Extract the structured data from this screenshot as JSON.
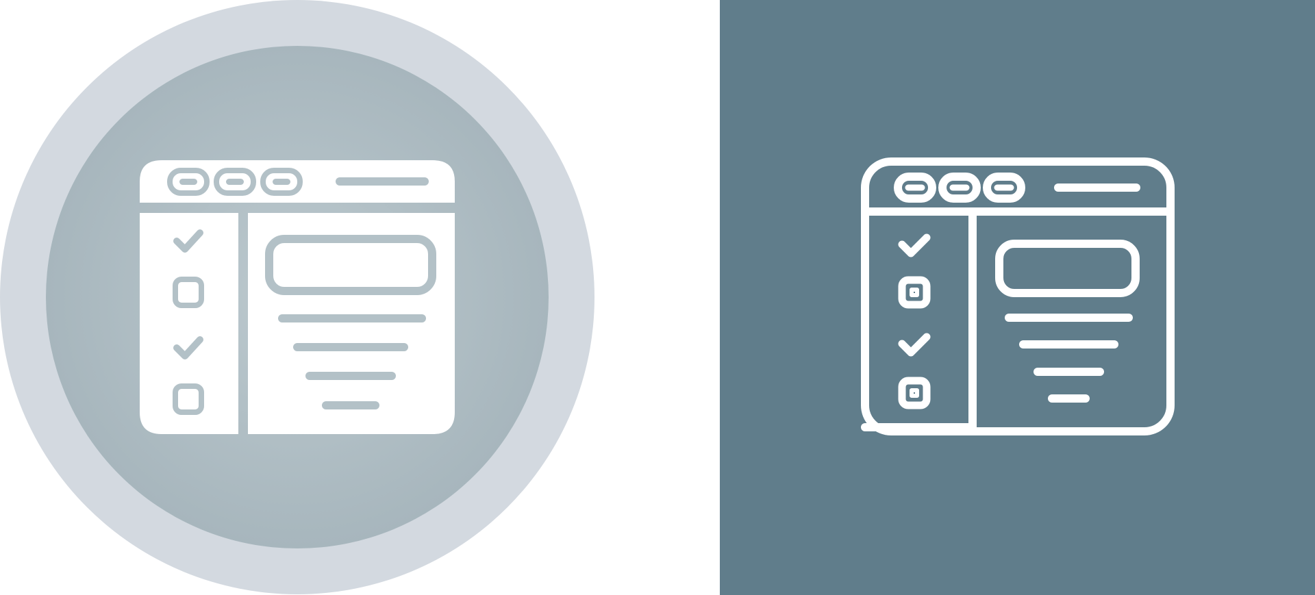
{
  "variants": [
    {
      "style": "glyph",
      "icon": "checklist-window-icon",
      "colors": {
        "panel": "#ffffff",
        "outer_ring": "#d2d8df",
        "outer_ring_edge": "#c6cdd6",
        "inner_disc_center": "#b7c4ca",
        "inner_disc_edge": "#a4b4bb",
        "glyph_fill": "#ffffff",
        "glyph_cut": "#b3c1c7"
      },
      "checklist": [
        "checked",
        "unchecked",
        "checked",
        "unchecked"
      ],
      "content_lines": 4
    },
    {
      "style": "outline",
      "icon": "checklist-window-icon",
      "colors": {
        "panel": "#607d8b",
        "stroke": "#ffffff"
      },
      "checklist": [
        "checked",
        "unchecked",
        "checked",
        "unchecked"
      ],
      "content_lines": 4
    }
  ]
}
